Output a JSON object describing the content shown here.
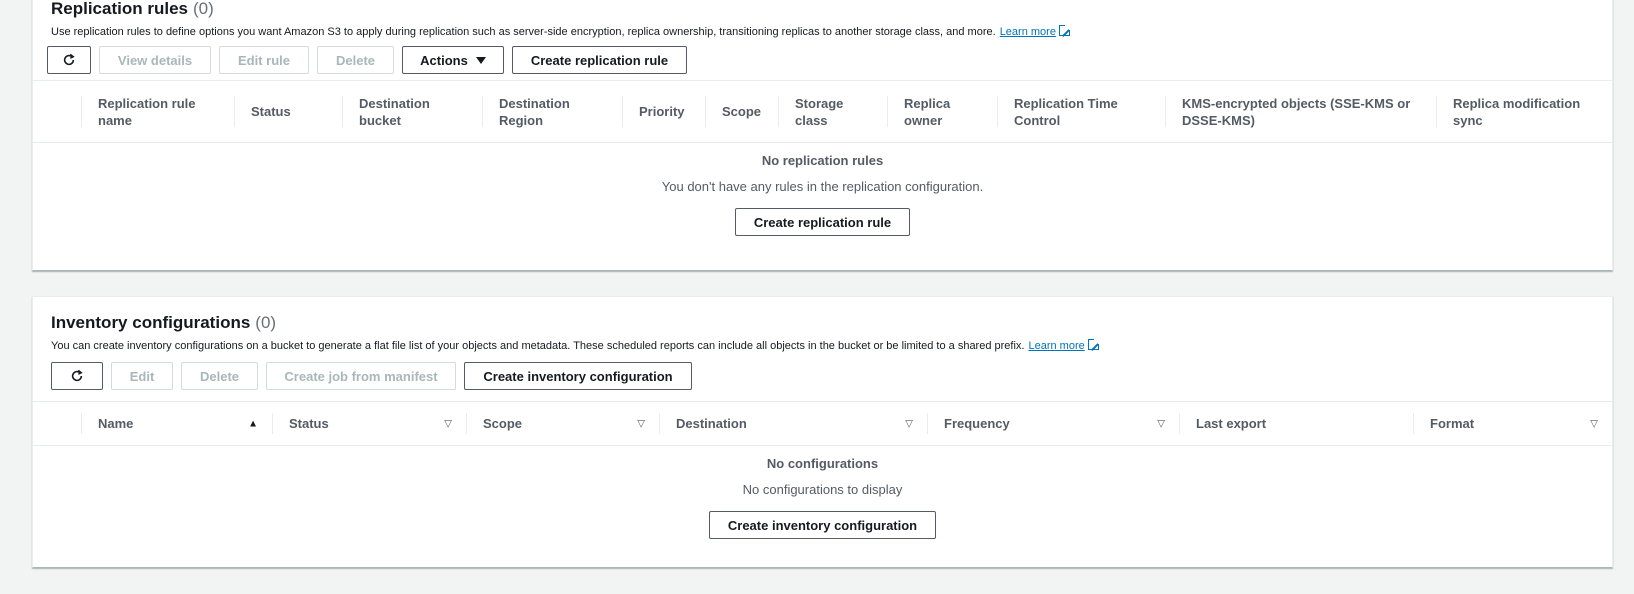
{
  "replication": {
    "title": "Replication rules",
    "count": "(0)",
    "description": "Use replication rules to define options you want Amazon S3 to apply during replication such as server-side encryption, replica ownership, transitioning replicas to another storage class, and more.",
    "learn_more": "Learn more",
    "toolbar": {
      "refresh_icon": "refresh-icon",
      "view_details": "View details",
      "edit_rule": "Edit rule",
      "delete": "Delete",
      "actions": "Actions",
      "create": "Create replication rule"
    },
    "columns": [
      "Replication rule name",
      "Status",
      "Destination bucket",
      "Destination Region",
      "Priority",
      "Scope",
      "Storage class",
      "Replica owner",
      "Replication Time Control",
      "KMS-encrypted objects (SSE-KMS or DSSE-KMS)",
      "Replica modification sync"
    ],
    "empty_title": "No replication rules",
    "empty_sub": "You don't have any rules in the replication configuration.",
    "empty_button": "Create replication rule"
  },
  "inventory": {
    "title": "Inventory configurations",
    "count": "(0)",
    "description": "You can create inventory configurations on a bucket to generate a flat file list of your objects and metadata. These scheduled reports can include all objects in the bucket or be limited to a shared prefix.",
    "learn_more": "Learn more",
    "toolbar": {
      "refresh_icon": "refresh-icon",
      "edit": "Edit",
      "delete": "Delete",
      "create_job": "Create job from manifest",
      "create": "Create inventory configuration"
    },
    "columns": [
      "Name",
      "Status",
      "Scope",
      "Destination",
      "Frequency",
      "Last export",
      "Format"
    ],
    "empty_title": "No configurations",
    "empty_sub": "No configurations to display",
    "empty_button": "Create inventory configuration"
  }
}
